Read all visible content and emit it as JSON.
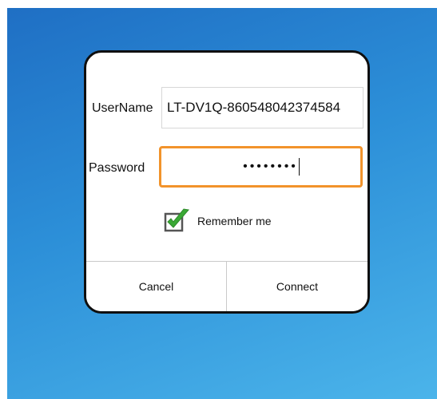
{
  "dialog": {
    "username_label": "UserName",
    "username_value": "LT-DV1Q-860548042374584",
    "password_label": "Password",
    "password_masked": "••••••••",
    "remember_label": "Remember me",
    "remember_checked": true,
    "cancel_label": "Cancel",
    "connect_label": "Connect"
  },
  "colors": {
    "focus_border": "#f2932b",
    "check_green": "#3aa935"
  }
}
